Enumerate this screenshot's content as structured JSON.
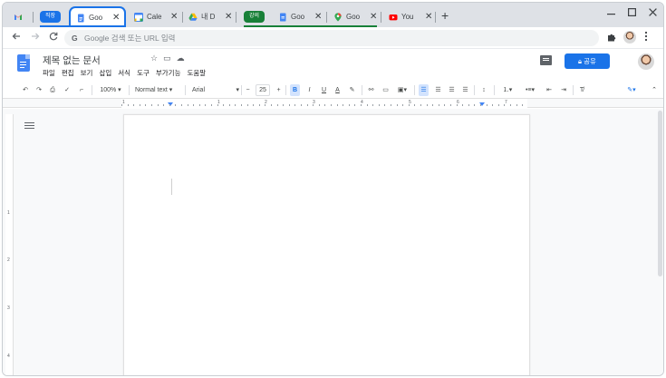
{
  "tabs": {
    "group1_label": "직장",
    "group2_label": "강의",
    "items": [
      {
        "title": "Goo",
        "icon": "docs-icon"
      },
      {
        "title": "Cale",
        "icon": "calendar-icon"
      },
      {
        "title": "내 D",
        "icon": "drive-icon"
      },
      {
        "title": "Goo",
        "icon": "docs-icon"
      },
      {
        "title": "Goo",
        "icon": "maps-icon"
      },
      {
        "title": "You",
        "icon": "youtube-icon"
      }
    ],
    "close_glyph": "✕",
    "new_tab_glyph": "+"
  },
  "colors": {
    "accent": "#1a73e8",
    "group2": "#188038",
    "tabstrip": "#dee1e6"
  },
  "omnibox": {
    "g_glyph": "G",
    "placeholder": "Google 검색 또는 URL 입력"
  },
  "docs": {
    "title": "제목 없는 문서",
    "menu": [
      "파일",
      "편집",
      "보기",
      "삽입",
      "서식",
      "도구",
      "부가기능",
      "도움말"
    ],
    "share_label": "공유"
  },
  "toolbar": {
    "zoom": "100%",
    "style": "Normal text",
    "font": "Arial",
    "font_size": "25",
    "minus": "−",
    "plus": "+",
    "bold": "B",
    "italic": "I",
    "underline": "U",
    "text_color": "A"
  },
  "ruler": {
    "numbers": [
      "1",
      "1",
      "2",
      "3",
      "4",
      "5",
      "6",
      "7"
    ]
  },
  "vruler": {
    "numbers": [
      "1",
      "2",
      "3",
      "4"
    ]
  }
}
